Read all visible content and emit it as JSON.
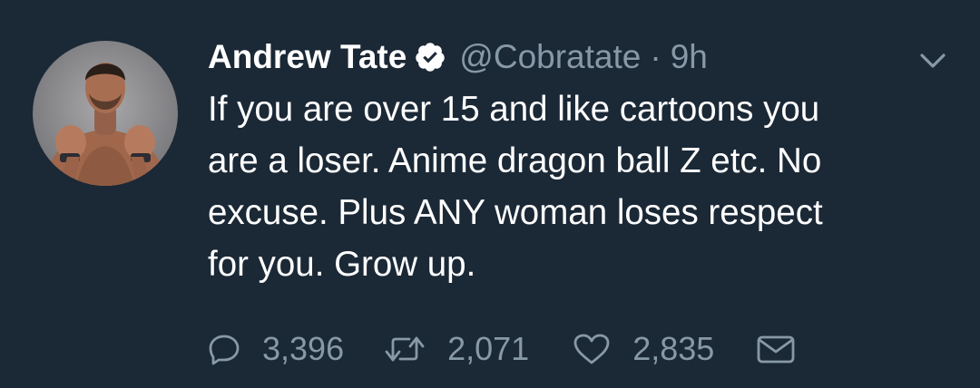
{
  "tweet": {
    "display_name": "Andrew Tate",
    "verified": true,
    "handle": "@Cobratate",
    "separator": "·",
    "time": "9h",
    "text": "If you are over 15 and like cartoons you\nare a loser. Anime dragon ball Z etc. No\nexcuse. Plus ANY woman loses respect\nfor you. Grow up.",
    "counts": {
      "replies": "3,396",
      "retweets": "2,071",
      "likes": "2,835"
    }
  },
  "colors": {
    "background": "#1b2836",
    "primary_text": "#ffffff",
    "secondary_text": "#8899a6"
  },
  "icons": {
    "reply": "speech-bubble-icon",
    "retweet": "retweet-arrows-icon",
    "like": "heart-icon",
    "share": "envelope-icon",
    "menu": "chevron-down-icon",
    "verified": "verified-badge-icon"
  }
}
